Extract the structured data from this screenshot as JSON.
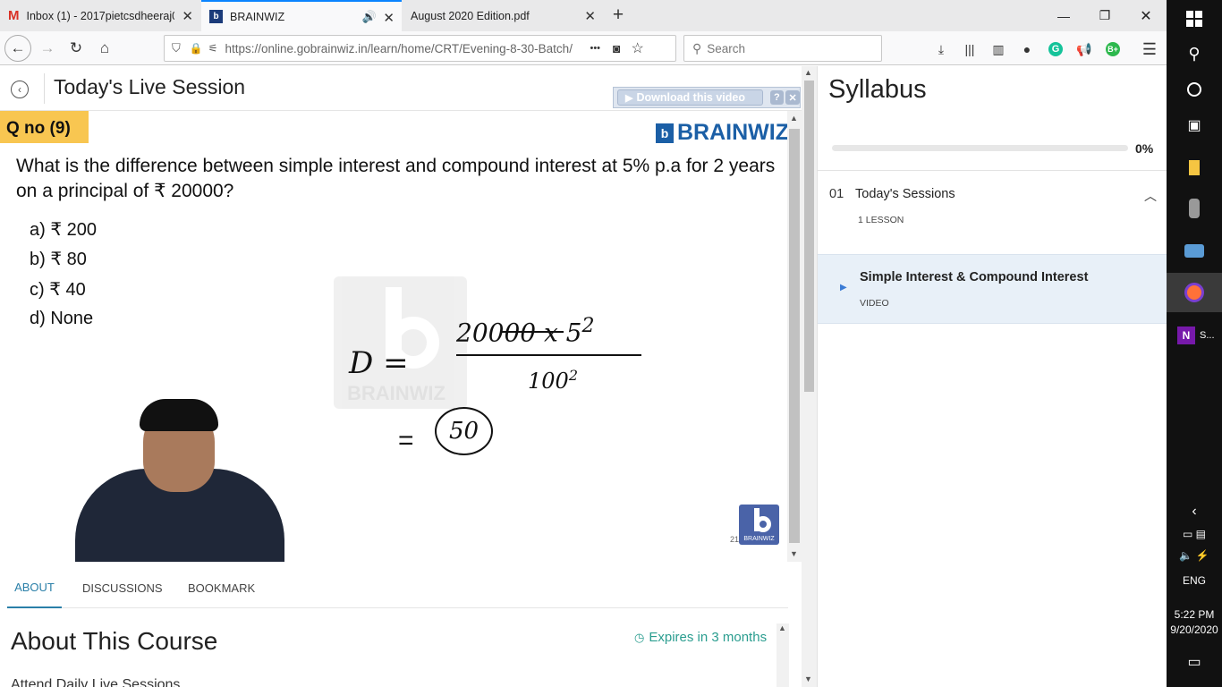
{
  "browser": {
    "tabs": [
      {
        "title": "Inbox (1) - 2017pietcsdheeraj0..."
      },
      {
        "title": "BRAINWIZ"
      },
      {
        "title": "August 2020 Edition.pdf"
      }
    ],
    "url": "https://online.gobrainwiz.in/learn/home/CRT/Evening-8-30-Batch/",
    "search_placeholder": "Search",
    "more_label": "•••"
  },
  "header": {
    "title": "Today's Live Session"
  },
  "video": {
    "download_label": "Download this video",
    "question_tag": "Q no (9)",
    "brand": "BRAINWIZ",
    "question": "What is the difference between simple interest and compound interest at 5% p.a for 2 years on a principal of ₹ 20000?",
    "options": [
      "a) ₹ 200",
      "b) ₹ 80",
      "c) ₹ 40",
      "d) None"
    ],
    "watermark": "BRAINWIZ",
    "corner_logo_text": "BRAINWIZ",
    "corner_number": "21",
    "handwriting": {
      "lhs": "D =",
      "numerator": "20000 x 5",
      "exponent": "2",
      "denominator": "100",
      "den_exp": "2",
      "result_eq": "=",
      "result": "50"
    }
  },
  "tabs": [
    {
      "label": "ABOUT",
      "active": true
    },
    {
      "label": "DISCUSSIONS",
      "active": false
    },
    {
      "label": "BOOKMARK",
      "active": false
    }
  ],
  "about": {
    "title": "About This Course",
    "expires": "Expires in 3 months",
    "first_line": "Attend Daily Live Sessions"
  },
  "syllabus": {
    "title": "Syllabus",
    "progress_text": "0%",
    "progress_value": 0,
    "section_num": "01",
    "section_title": "Today's Sessions",
    "section_sub": "1 LESSON",
    "lesson_title": "Simple Interest & Compound Interest",
    "lesson_type": "VIDEO"
  },
  "taskbar": {
    "onenote_label": "S...",
    "lang": "ENG",
    "time": "5:22 PM",
    "date": "9/20/2020"
  },
  "colors": {
    "accent": "#2a7fa8",
    "tag_bg": "#f8c651",
    "brand_blue": "#1b5fa6",
    "lesson_bg": "#e8f0f8"
  }
}
